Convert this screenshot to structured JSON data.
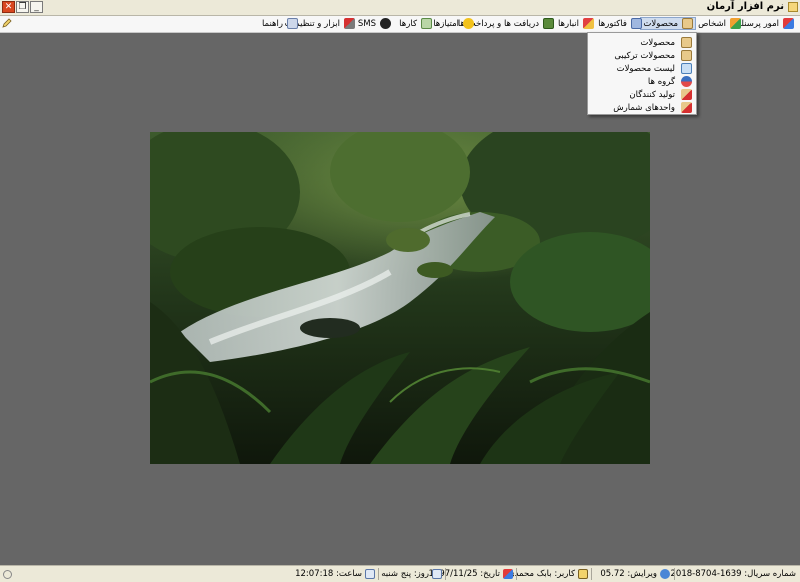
{
  "window": {
    "title": "نرم افزار آرمان",
    "buttons": {
      "close": "✕",
      "restore": "❐",
      "minimize": "_"
    }
  },
  "menu": {
    "items": [
      {
        "label": "امور پرسنلی",
        "icon": "personnel-icon"
      },
      {
        "label": "اشخاص",
        "icon": "persons-icon"
      },
      {
        "label": "محصولات",
        "icon": "products-icon",
        "active": true
      },
      {
        "label": "فاکتورها",
        "icon": "invoices-icon"
      },
      {
        "label": "انبارها",
        "icon": "warehouse-icon"
      },
      {
        "label": "دریافت ها و پرداخت ها",
        "icon": "payments-icon"
      },
      {
        "label": "امتیازها",
        "icon": "star-icon"
      },
      {
        "label": "کارها",
        "icon": "tasks-icon"
      },
      {
        "label": "SMS",
        "icon": "sms-icon"
      },
      {
        "label": "ابزار و تنظیمات",
        "icon": "tools-icon"
      },
      {
        "label": "راهنما",
        "icon": "help-icon"
      }
    ]
  },
  "dropdown": {
    "items": [
      {
        "label": "محصولات",
        "icon": "product-box-icon"
      },
      {
        "label": "محصولات ترکیبی",
        "icon": "combined-products-icon"
      },
      {
        "label": "لیست محصولات",
        "icon": "product-list-icon"
      },
      {
        "label": "گروه ها",
        "icon": "groups-icon"
      },
      {
        "label": "تولید کنندگان",
        "icon": "manufacturers-icon"
      },
      {
        "label": "واحدهای شمارش",
        "icon": "units-icon"
      }
    ]
  },
  "status": {
    "serial": "شماره سریال: 1639-8704-2018",
    "version": "ویرایش: 05.72",
    "user": "کاربر: بابک محمدی",
    "date": "تاریخ: 1397/11/25",
    "day": "روز: پنج شنبه",
    "time": "ساعت: 12:07:18"
  },
  "colors": {
    "background": "#666666",
    "menu_active": "#cfdcee",
    "close_button": "#d9471f"
  }
}
